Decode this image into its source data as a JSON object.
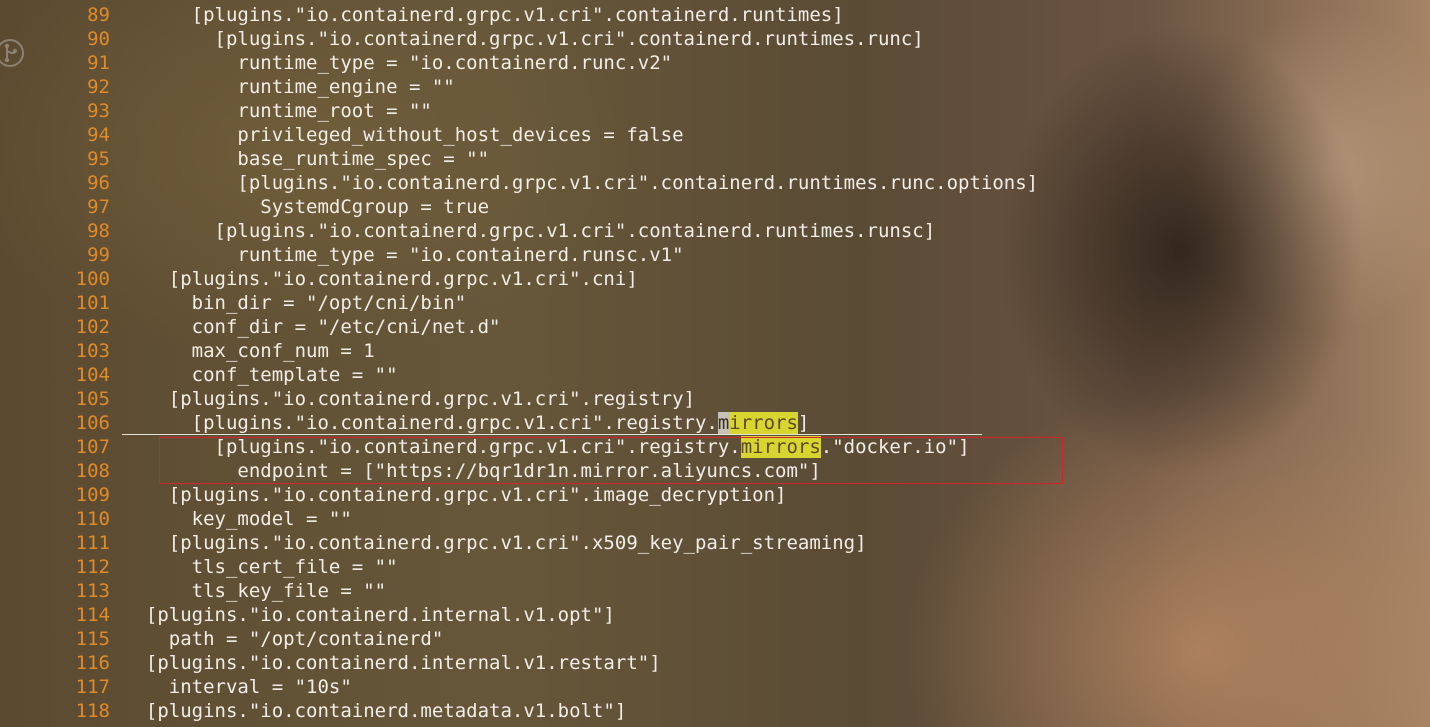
{
  "editor": {
    "icons": {
      "gutter": "git-branch-icon"
    },
    "colors": {
      "line_number": "#e08a2a",
      "text": "#f2ede6",
      "search_highlight": "#d8d430",
      "selection_box": "#d1252b"
    },
    "lines": [
      {
        "num": "89",
        "text": "      [plugins.\"io.containerd.grpc.v1.cri\".containerd.runtimes]"
      },
      {
        "num": "90",
        "text": "        [plugins.\"io.containerd.grpc.v1.cri\".containerd.runtimes.runc]"
      },
      {
        "num": "91",
        "text": "          runtime_type = \"io.containerd.runc.v2\""
      },
      {
        "num": "92",
        "text": "          runtime_engine = \"\""
      },
      {
        "num": "93",
        "text": "          runtime_root = \"\""
      },
      {
        "num": "94",
        "text": "          privileged_without_host_devices = false"
      },
      {
        "num": "95",
        "text": "          base_runtime_spec = \"\""
      },
      {
        "num": "96",
        "text": "          [plugins.\"io.containerd.grpc.v1.cri\".containerd.runtimes.runc.options]"
      },
      {
        "num": "97",
        "text": "            SystemdCgroup = true"
      },
      {
        "num": "98",
        "text": "        [plugins.\"io.containerd.grpc.v1.cri\".containerd.runtimes.runsc]"
      },
      {
        "num": "99",
        "text": "          runtime_type = \"io.containerd.runsc.v1\""
      },
      {
        "num": "100",
        "text": "    [plugins.\"io.containerd.grpc.v1.cri\".cni]"
      },
      {
        "num": "101",
        "text": "      bin_dir = \"/opt/cni/bin\""
      },
      {
        "num": "102",
        "text": "      conf_dir = \"/etc/cni/net.d\""
      },
      {
        "num": "103",
        "text": "      max_conf_num = 1"
      },
      {
        "num": "104",
        "text": "      conf_template = \"\""
      },
      {
        "num": "105",
        "text": "    [plugins.\"io.containerd.grpc.v1.cri\".registry]"
      },
      {
        "num": "106",
        "before": "      [plugins.\"io.containerd.grpc.v1.cri\".registry.",
        "m_char": "m",
        "match": "irrors",
        "after": "]"
      },
      {
        "num": "107",
        "before": "        [plugins.\"io.containerd.grpc.v1.cri\".registry.",
        "match": "mirrors",
        "after": ".\"docker.io\"]"
      },
      {
        "num": "108",
        "text": "          endpoint = [\"https://bqr1dr1n.mirror.aliyuncs.com\"]"
      },
      {
        "num": "109",
        "text": "    [plugins.\"io.containerd.grpc.v1.cri\".image_decryption]"
      },
      {
        "num": "110",
        "text": "      key_model = \"\""
      },
      {
        "num": "111",
        "text": "    [plugins.\"io.containerd.grpc.v1.cri\".x509_key_pair_streaming]"
      },
      {
        "num": "112",
        "text": "      tls_cert_file = \"\""
      },
      {
        "num": "113",
        "text": "      tls_key_file = \"\""
      },
      {
        "num": "114",
        "text": "  [plugins.\"io.containerd.internal.v1.opt\"]"
      },
      {
        "num": "115",
        "text": "    path = \"/opt/containerd\""
      },
      {
        "num": "116",
        "text": "  [plugins.\"io.containerd.internal.v1.restart\"]"
      },
      {
        "num": "117",
        "text": "    interval = \"10s\""
      },
      {
        "num": "118",
        "text": "  [plugins.\"io.containerd.metadata.v1.bolt\"]"
      }
    ]
  }
}
